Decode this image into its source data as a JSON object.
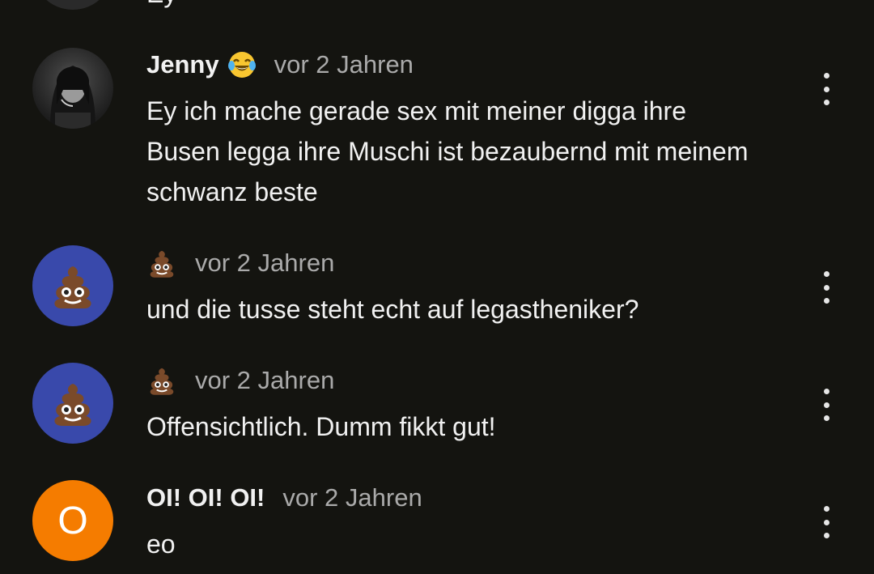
{
  "partial_comment": {
    "text": "Ey"
  },
  "comments": [
    {
      "author": "Jenny",
      "author_icon": "laughing-tears-emoji",
      "time": "vor 2 Jahren",
      "text": "Ey ich mache gerade sex mit meiner digga ihre Busen legga ihre Muschi ist bezaubernd mit meinem schwanz beste",
      "avatar": "photo"
    },
    {
      "author": "",
      "author_icon": "pile-of-poo-emoji",
      "time": "vor 2 Jahren",
      "text": "und die tusse steht echt auf legastheniker?",
      "avatar": "pile-of-poo-emoji",
      "avatar_color": "#3949ab"
    },
    {
      "author": "",
      "author_icon": "pile-of-poo-emoji",
      "time": "vor 2 Jahren",
      "text": "Offensichtlich. Dumm fikkt gut!",
      "avatar": "pile-of-poo-emoji",
      "avatar_color": "#3949ab"
    },
    {
      "author": "OI! OI! OI!",
      "time": "vor 2 Jahren",
      "text": "eo",
      "avatar_letter": "O",
      "avatar_color": "#f57c00"
    }
  ],
  "colors": {
    "background": "#141410",
    "text": "#f1f1f1",
    "meta": "#aaaaaa"
  }
}
